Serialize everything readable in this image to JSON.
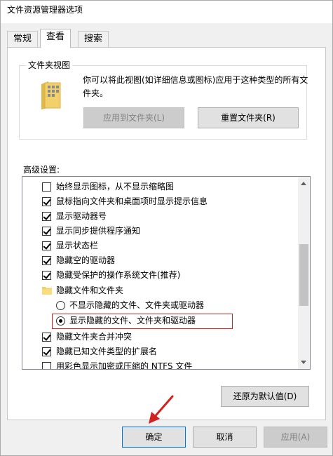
{
  "window": {
    "title": "文件资源管理器选项"
  },
  "tabs": [
    {
      "label": "常规",
      "active": false
    },
    {
      "label": "查看",
      "active": true
    },
    {
      "label": "搜索",
      "active": false
    }
  ],
  "folder_view": {
    "group_label": "文件夹视图",
    "description": "你可以将此视图(如详细信息或图标)应用于这种类型的所有文件夹。",
    "apply_button": "应用到文件夹(L)",
    "reset_button": "重置文件夹(R)"
  },
  "advanced": {
    "label": "高级设置:",
    "items": [
      {
        "type": "checkbox",
        "checked": false,
        "label": "始终显示图标，从不显示缩略图"
      },
      {
        "type": "checkbox",
        "checked": true,
        "label": "鼠标指向文件夹和桌面项时显示提示信息"
      },
      {
        "type": "checkbox",
        "checked": true,
        "label": "显示驱动器号"
      },
      {
        "type": "checkbox",
        "checked": true,
        "label": "显示同步提供程序通知"
      },
      {
        "type": "checkbox",
        "checked": true,
        "label": "显示状态栏"
      },
      {
        "type": "checkbox",
        "checked": true,
        "label": "隐藏空的驱动器"
      },
      {
        "type": "checkbox",
        "checked": true,
        "label": "隐藏受保护的操作系统文件(推荐)"
      },
      {
        "type": "folder",
        "label": "隐藏文件和文件夹"
      },
      {
        "type": "radio",
        "checked": false,
        "label": "不显示隐藏的文件、文件夹或驱动器"
      },
      {
        "type": "radio",
        "checked": true,
        "label": "显示隐藏的文件、文件夹和驱动器"
      },
      {
        "type": "checkbox",
        "checked": true,
        "label": "隐藏文件夹合并冲突"
      },
      {
        "type": "checkbox",
        "checked": true,
        "label": "隐藏已知文件类型的扩展名"
      },
      {
        "type": "checkbox",
        "checked": false,
        "label": "用彩色显示加密或压缩的 NTFS 文件"
      }
    ],
    "restore_defaults_button": "还原为默认值(D)"
  },
  "footer": {
    "ok_button": "确定",
    "cancel_button": "取消",
    "apply_button": "应用(A)"
  },
  "colors": {
    "highlight": "#d32020",
    "accent": "#0078d7"
  }
}
